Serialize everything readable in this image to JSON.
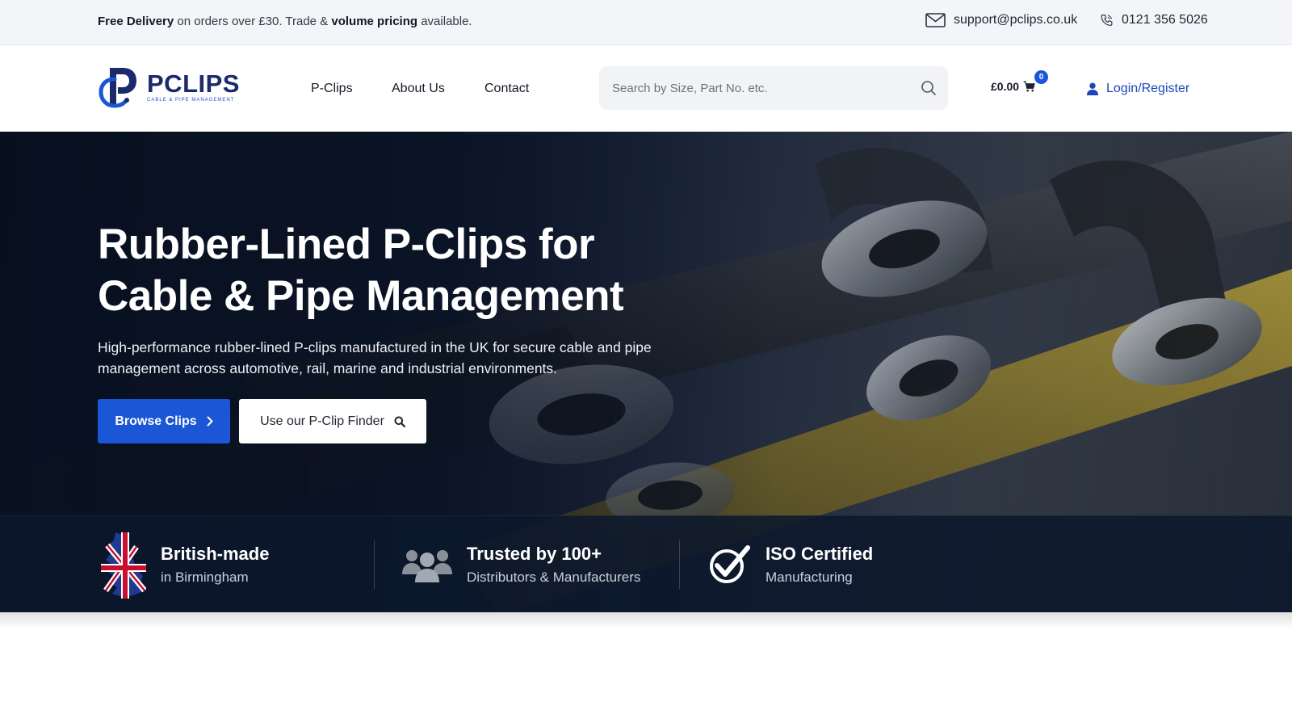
{
  "topbar": {
    "promo_bold1": "Free Delivery",
    "promo_text1": " on orders over £30. Trade & ",
    "promo_bold2": "volume pricing",
    "promo_text2": " available.",
    "email": "support@pclips.co.uk",
    "phone": "0121 356 5026"
  },
  "header": {
    "logo_name": "PCLIPS",
    "logo_tagline": "CABLE & PIPE MANAGEMENT",
    "nav": [
      {
        "label": "P-Clips"
      },
      {
        "label": "About Us"
      },
      {
        "label": "Contact"
      }
    ],
    "search_placeholder": "Search by Size, Part No. etc.",
    "cart_total": "£0.00",
    "cart_count": "0",
    "login_label": "Login/Register"
  },
  "hero": {
    "title_line1": "Rubber-Lined P-Clips for",
    "title_line2": "Cable & Pipe Management",
    "subtitle": "High-performance rubber-lined P-clips manufactured in the UK for secure cable and pipe management across automotive, rail, marine and industrial environments.",
    "primary_button": "Browse Clips",
    "secondary_button": "Use our P-Clip Finder"
  },
  "trust": [
    {
      "title": "British-made",
      "subtitle": "in Birmingham",
      "icon": "uk-map-flag-icon"
    },
    {
      "title": "Trusted by 100+",
      "subtitle": "Distributors & Manufacturers",
      "icon": "people-group-icon"
    },
    {
      "title": "ISO Certified",
      "subtitle": "Manufacturing",
      "icon": "check-circle-icon"
    }
  ],
  "colors": {
    "brand_blue": "#1a56d6",
    "logo_navy": "#1a2a6c",
    "hero_bg": "#0d1729"
  }
}
